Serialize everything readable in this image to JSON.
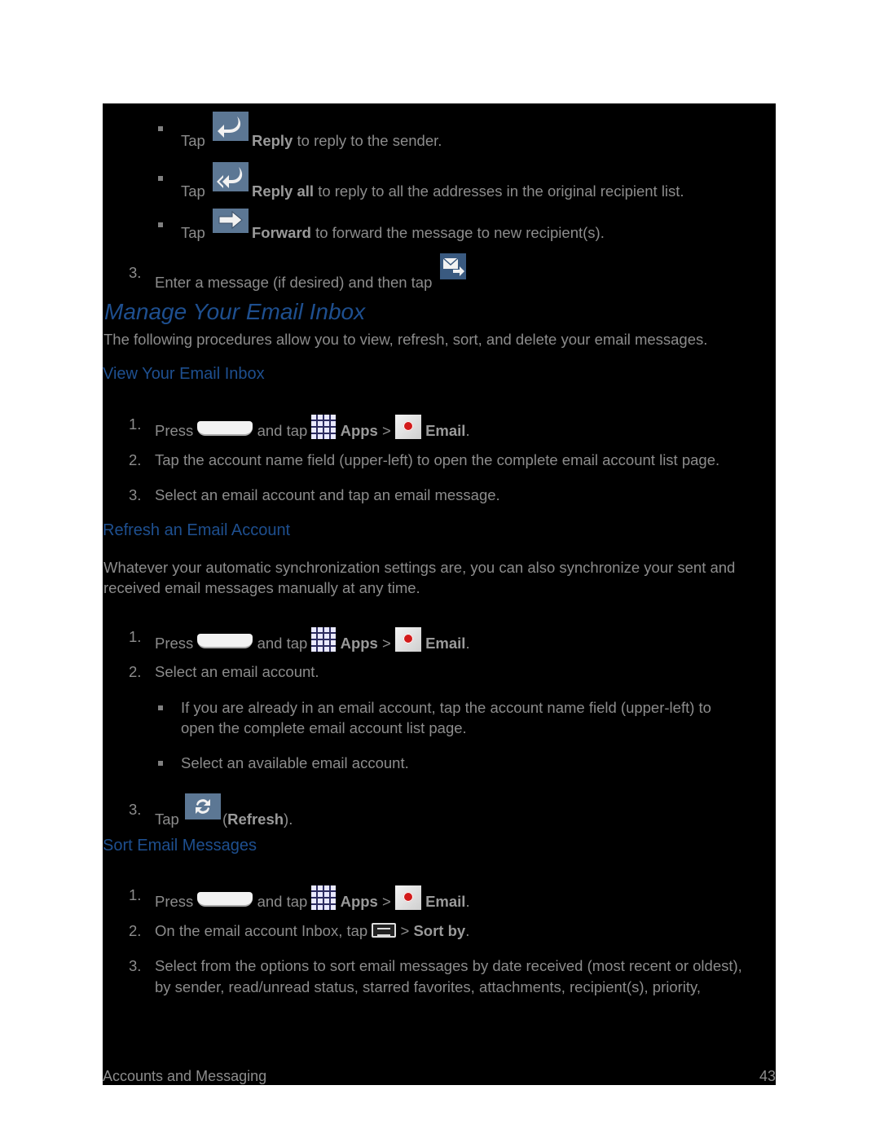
{
  "intro_bullets": [
    {
      "tap": "Tap",
      "icon": "reply-icon",
      "action": "Reply",
      "rest": " to reply to the sender."
    },
    {
      "tap": "Tap",
      "icon": "reply-all-icon",
      "action": "Reply all",
      "rest": " to reply to all the addresses in the original recipient list."
    },
    {
      "tap": "Tap",
      "icon": "forward-icon",
      "action": "Forward",
      "rest": " to forward the message to new recipient(s)."
    }
  ],
  "step3": {
    "num": "3.",
    "text": "Enter a message (if desired) and then tap",
    "icon": "send-icon"
  },
  "manage": {
    "title": "Manage Your Email Inbox",
    "intro": "The following procedures allow you to view, refresh, sort, and delete your email messages."
  },
  "view": {
    "title": "View Your Email Inbox",
    "steps": [
      {
        "num": "1.",
        "press": "Press",
        "and_tap": "and tap",
        "apps": "Apps",
        "sep": ">",
        "email": "Email",
        "end": "."
      },
      {
        "num": "2.",
        "text": "Tap the account name field (upper-left) to open the complete email account list page."
      },
      {
        "num": "3.",
        "text": "Select an email account and tap an email message."
      }
    ]
  },
  "refresh": {
    "title": "Refresh an Email Account",
    "intro_line1": "Whatever your automatic synchronization settings are, you can also synchronize your sent and",
    "intro_line2": "received email messages manually at any time.",
    "steps": [
      {
        "num": "1.",
        "press": "Press",
        "and_tap": "and tap",
        "apps": "Apps",
        "sep": ">",
        "email": "Email",
        "end": "."
      },
      {
        "num": "2.",
        "text": "Select an email account."
      },
      {
        "num": "3.",
        "tap": "Tap",
        "open": "(",
        "action": "Refresh",
        "close": ")."
      }
    ],
    "sub_bullets": [
      {
        "line1": "If you are already in an email account, tap the account name field (upper-left) to",
        "line2": "open the complete email account list page."
      },
      {
        "line1": "Select an available email account."
      }
    ]
  },
  "sort": {
    "title": "Sort Email Messages",
    "steps": [
      {
        "num": "1.",
        "press": "Press",
        "and_tap": "and tap",
        "apps": "Apps",
        "sep": ">",
        "email": "Email",
        "end": "."
      },
      {
        "num": "2.",
        "text": "On the email account Inbox, tap",
        "sep": ">",
        "action": "Sort by",
        "end": "."
      },
      {
        "num": "3.",
        "line1": "Select from the options to sort email messages by date received (most recent or oldest),",
        "line2": "by sender, read/unread status, starred favorites, attachments, recipient(s), priority,"
      }
    ]
  },
  "footer": {
    "section": "Accounts and Messaging",
    "page": "43"
  },
  "colors": {
    "heading": "#1e4f8f",
    "body_text": "#8c8c8c",
    "icon_blue": "#5c7794",
    "background": "#000000"
  }
}
